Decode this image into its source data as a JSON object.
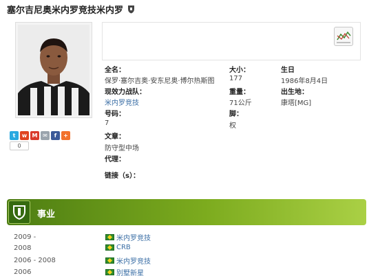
{
  "page_title": "塞尔吉尼奥米内罗竞技米内罗",
  "share": {
    "count": "0"
  },
  "details": {
    "fullname_label": "全名：",
    "fullname": "保罗·塞尔吉奥·安东尼奥·博尔热斯图",
    "team_label": "现效力战队：",
    "team": "米内罗竞技",
    "number_label": "号码：",
    "number": "7",
    "position_label": "文章：",
    "position": "防守型中场",
    "agent_label": "代理：",
    "links_label": "链接（s）：",
    "height_label": "大小：",
    "height": "177",
    "weight_label": "重量：",
    "weight": "71公斤",
    "foot_label": "脚：",
    "foot": "权",
    "birth_label": "生日",
    "birth": "1986年8月4日",
    "birthplace_label": "出生地：",
    "birthplace": "康塔[MG]"
  },
  "career": {
    "title": "事业",
    "rows": [
      {
        "years": "2009 -",
        "club": "米内罗竞技"
      },
      {
        "years": "2008",
        "club": "CRB"
      },
      {
        "years": "2006 - 2008",
        "club": "米内罗竞技"
      },
      {
        "years": "2006",
        "club": "别墅新星"
      }
    ]
  }
}
